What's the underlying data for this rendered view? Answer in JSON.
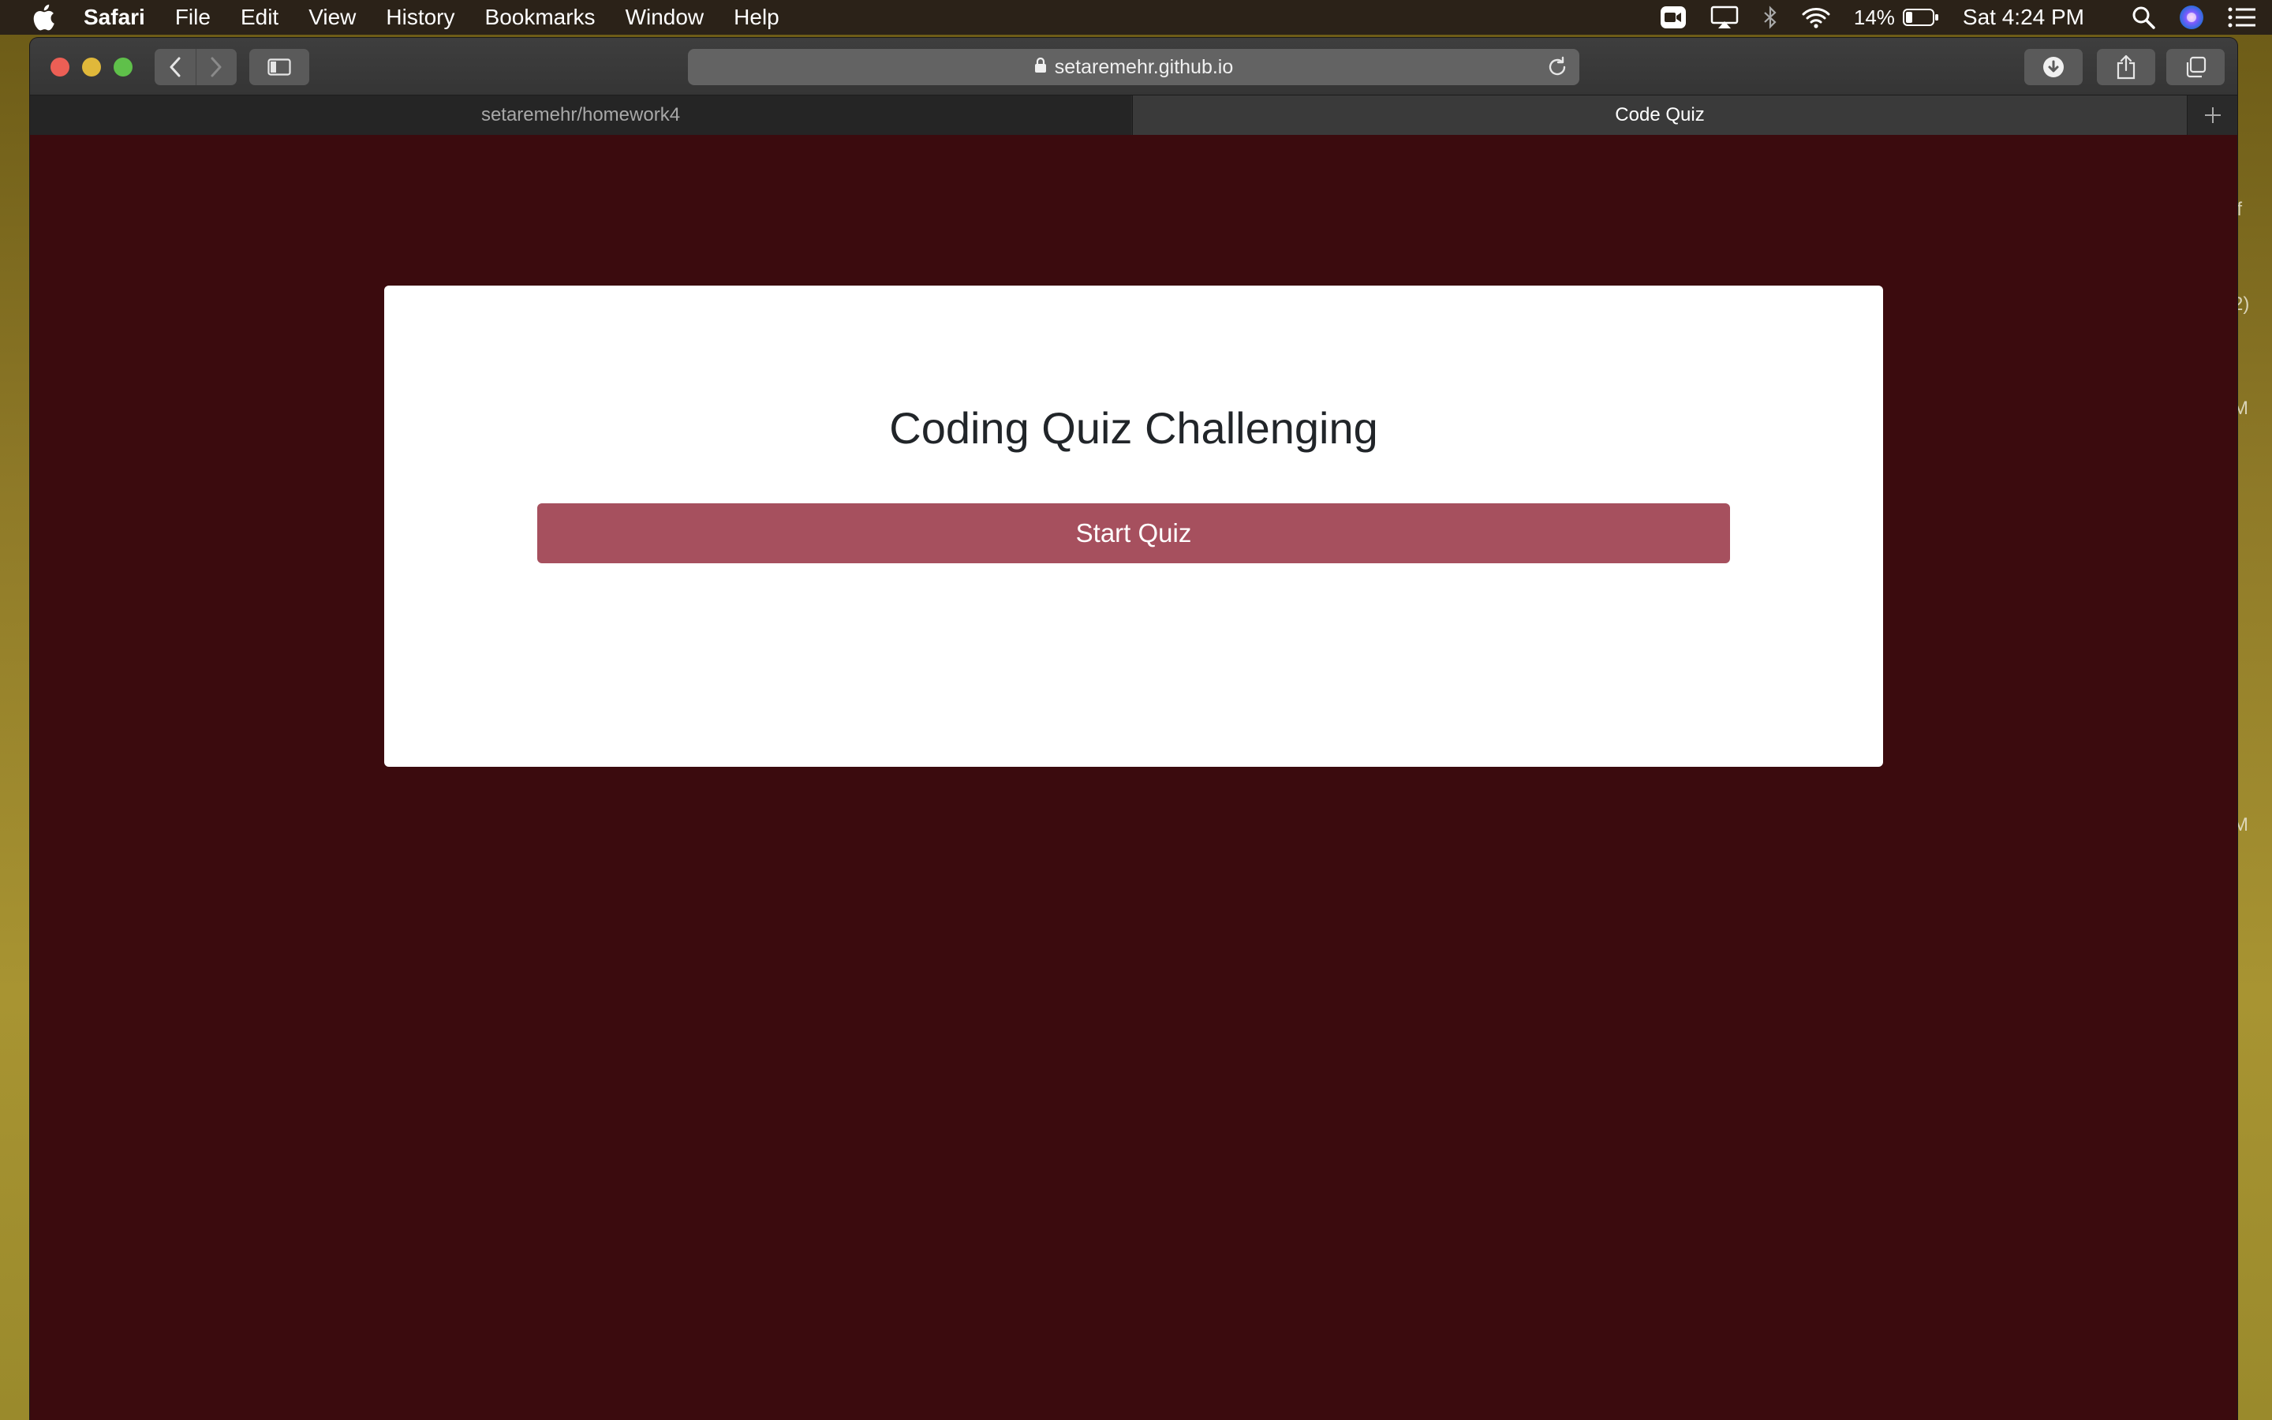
{
  "menubar": {
    "app_name": "Safari",
    "items": [
      "File",
      "Edit",
      "View",
      "History",
      "Bookmarks",
      "Window",
      "Help"
    ],
    "battery": "14%",
    "clock": "Sat 4:24 PM"
  },
  "browser": {
    "url": "setaremehr.github.io",
    "tabs": [
      {
        "label": "setaremehr/homework4",
        "active": false
      },
      {
        "label": "Code Quiz",
        "active": true
      }
    ]
  },
  "page": {
    "title": "Coding Quiz Challenging",
    "start_button": "Start Quiz"
  },
  "desktop": {
    "fragments": [
      "lf",
      "2)",
      "M",
      "M"
    ]
  },
  "colors": {
    "page_background": "#3b0b0e",
    "button": "#a6505e",
    "card": "#ffffff"
  }
}
